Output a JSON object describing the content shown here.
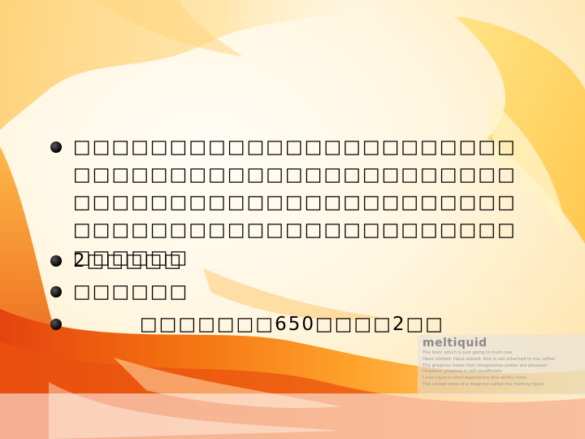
{
  "bullets": [
    {
      "text": "□□□□□□□□□□□□□□□□□□□□□□□□□□□□□□□□□□□□□□□□□□□□□□□□□□□□□□□□□□□□□□□□□□□□□□□□□□□□□□□□□□□□□□□□□□□□□□□□□□"
    },
    {
      "text": "2□□□□□"
    },
    {
      "text": "□□□□□□"
    },
    {
      "text": "□□□□□□□650□□□□2□□"
    }
  ],
  "brand": {
    "title": "meltiquid",
    "lines": [
      "The toxic which is just going to melt now",
      "Have melted. Have solved. Aim is not attached to me, either",
      "The graphics made from imaginative power are pleasant",
      "However, practice is still insufficient",
      "I also have to start experience and ability more",
      "The coined word of a meaning called the melting liquid"
    ]
  },
  "colors": {
    "accent_orange": "#f07a10",
    "accent_red": "#e34a10",
    "accent_yellow": "#ffd75a"
  }
}
